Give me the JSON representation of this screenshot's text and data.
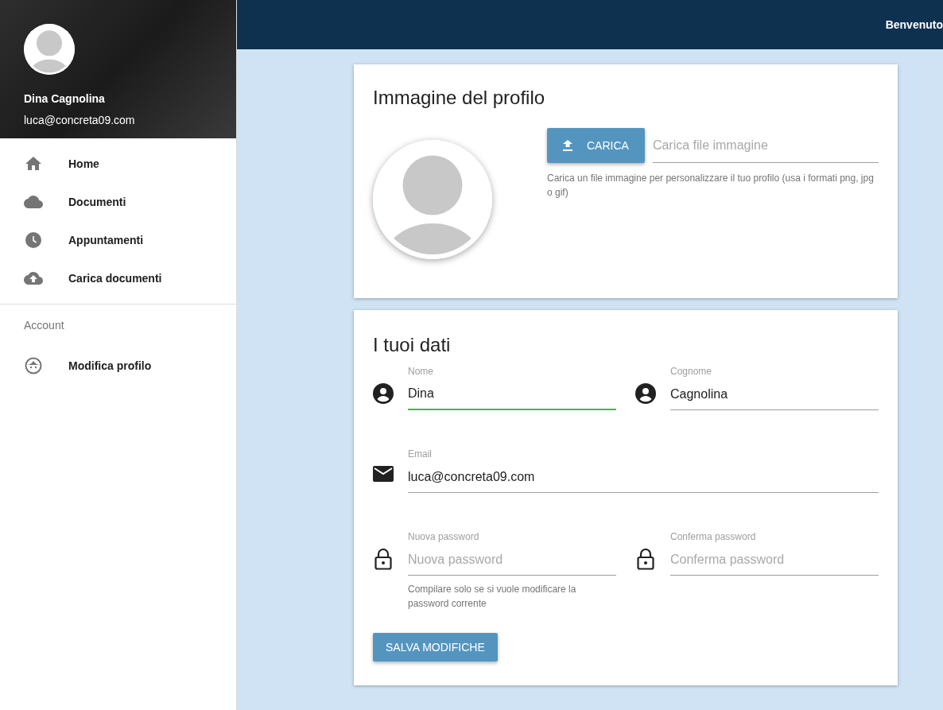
{
  "sidebar": {
    "user": {
      "name": "Dina Cagnolina",
      "email": "luca@concreta09.com"
    },
    "items": [
      {
        "label": "Home",
        "kind": "home"
      },
      {
        "label": "Documenti",
        "kind": "cloud"
      },
      {
        "label": "Appuntamenti",
        "kind": "clock"
      },
      {
        "label": "Carica documenti",
        "kind": "upload"
      }
    ],
    "section": "Account",
    "account_items": [
      {
        "label": "Modifica profilo",
        "kind": "face"
      }
    ]
  },
  "header": {
    "greeting": "Benvenuto"
  },
  "profile_card": {
    "title": "Immagine del profilo",
    "upload_button": "CARICA",
    "file_field": {
      "placeholder": "Carica file immagine"
    },
    "hint": "Carica un file immagine per personalizzare il tuo profilo (usa i formati png, jpg o gif)"
  },
  "data_card": {
    "title": "I tuoi dati",
    "rows": [
      [
        {
          "kind": "person",
          "label": "Nome",
          "value": "Dina",
          "focused": true
        },
        {
          "kind": "person",
          "label": "Cognome",
          "value": "Cagnolina",
          "focused": false
        }
      ],
      [
        {
          "kind": "mail",
          "label": "Email",
          "value": "luca@concreta09.com",
          "focused": false
        }
      ],
      [
        {
          "kind": "lock",
          "label": "Nuova password",
          "placeholder": "Nuova password",
          "focused": false,
          "hint": "Compilare solo se si vuole modificare la password corrente"
        },
        {
          "kind": "lock",
          "label": "Conferma password",
          "placeholder": "Conferma password",
          "focused": false
        }
      ]
    ],
    "save_button": "SALVA MODIFICHE"
  }
}
